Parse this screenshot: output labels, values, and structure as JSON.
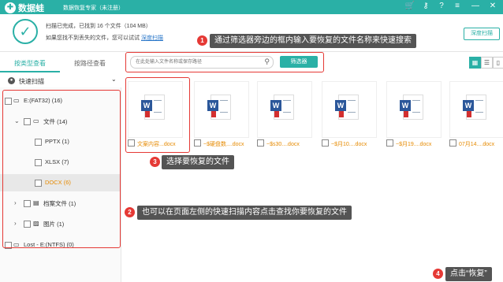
{
  "app": {
    "name": "数据蛙",
    "subtitle": "数据恢复专家（未注册）"
  },
  "window": {
    "cart": "🛒",
    "key": "⚷",
    "help": "?",
    "menu": "≡",
    "min": "—",
    "close": "✕"
  },
  "header": {
    "line1": "扫描已完成，已找到 16 个文件（104 MB）",
    "line2_prefix": "如果您找不到丢失的文件，您可以试试",
    "line2_link": "深度扫描",
    "deep_scan_button": "深度扫描"
  },
  "tabs": [
    "按类型查看",
    "按路径查看"
  ],
  "quick_scan_label": "快速扫描",
  "tree": [
    {
      "label": "E:(FAT32) (16)"
    },
    {
      "label": "文件 (14)"
    },
    {
      "label": "PPTX (1)"
    },
    {
      "label": "XLSX (7)"
    },
    {
      "label": "DOCX (6)"
    },
    {
      "label": "档案文件 (1)"
    },
    {
      "label": "图片 (1)"
    },
    {
      "label": "Lost - E:(NTFS) (0)"
    }
  ],
  "search": {
    "placeholder": "在此处输入文件名称或保存路径"
  },
  "filter_button": "筛选器",
  "files": [
    "文案内容...docx",
    "~$硬盘数....docx",
    "~$s30....docx",
    "~$月10....docx",
    "~$月19....docx",
    "07月14....docx"
  ],
  "callouts": {
    "c1": "通过筛选器旁边的框内输入要恢复的文件名称来快速搜索",
    "c2": "也可以在页面左侧的快速扫描内容点击查找你要恢复的文件",
    "c3": "选择要恢复的文件",
    "c4": "点击“恢复”"
  },
  "callout_numbers": [
    "1",
    "2",
    "3",
    "4"
  ],
  "colors": {
    "accent": "#2ab0a6",
    "highlight": "#e53935",
    "filename": "#e68a00"
  }
}
